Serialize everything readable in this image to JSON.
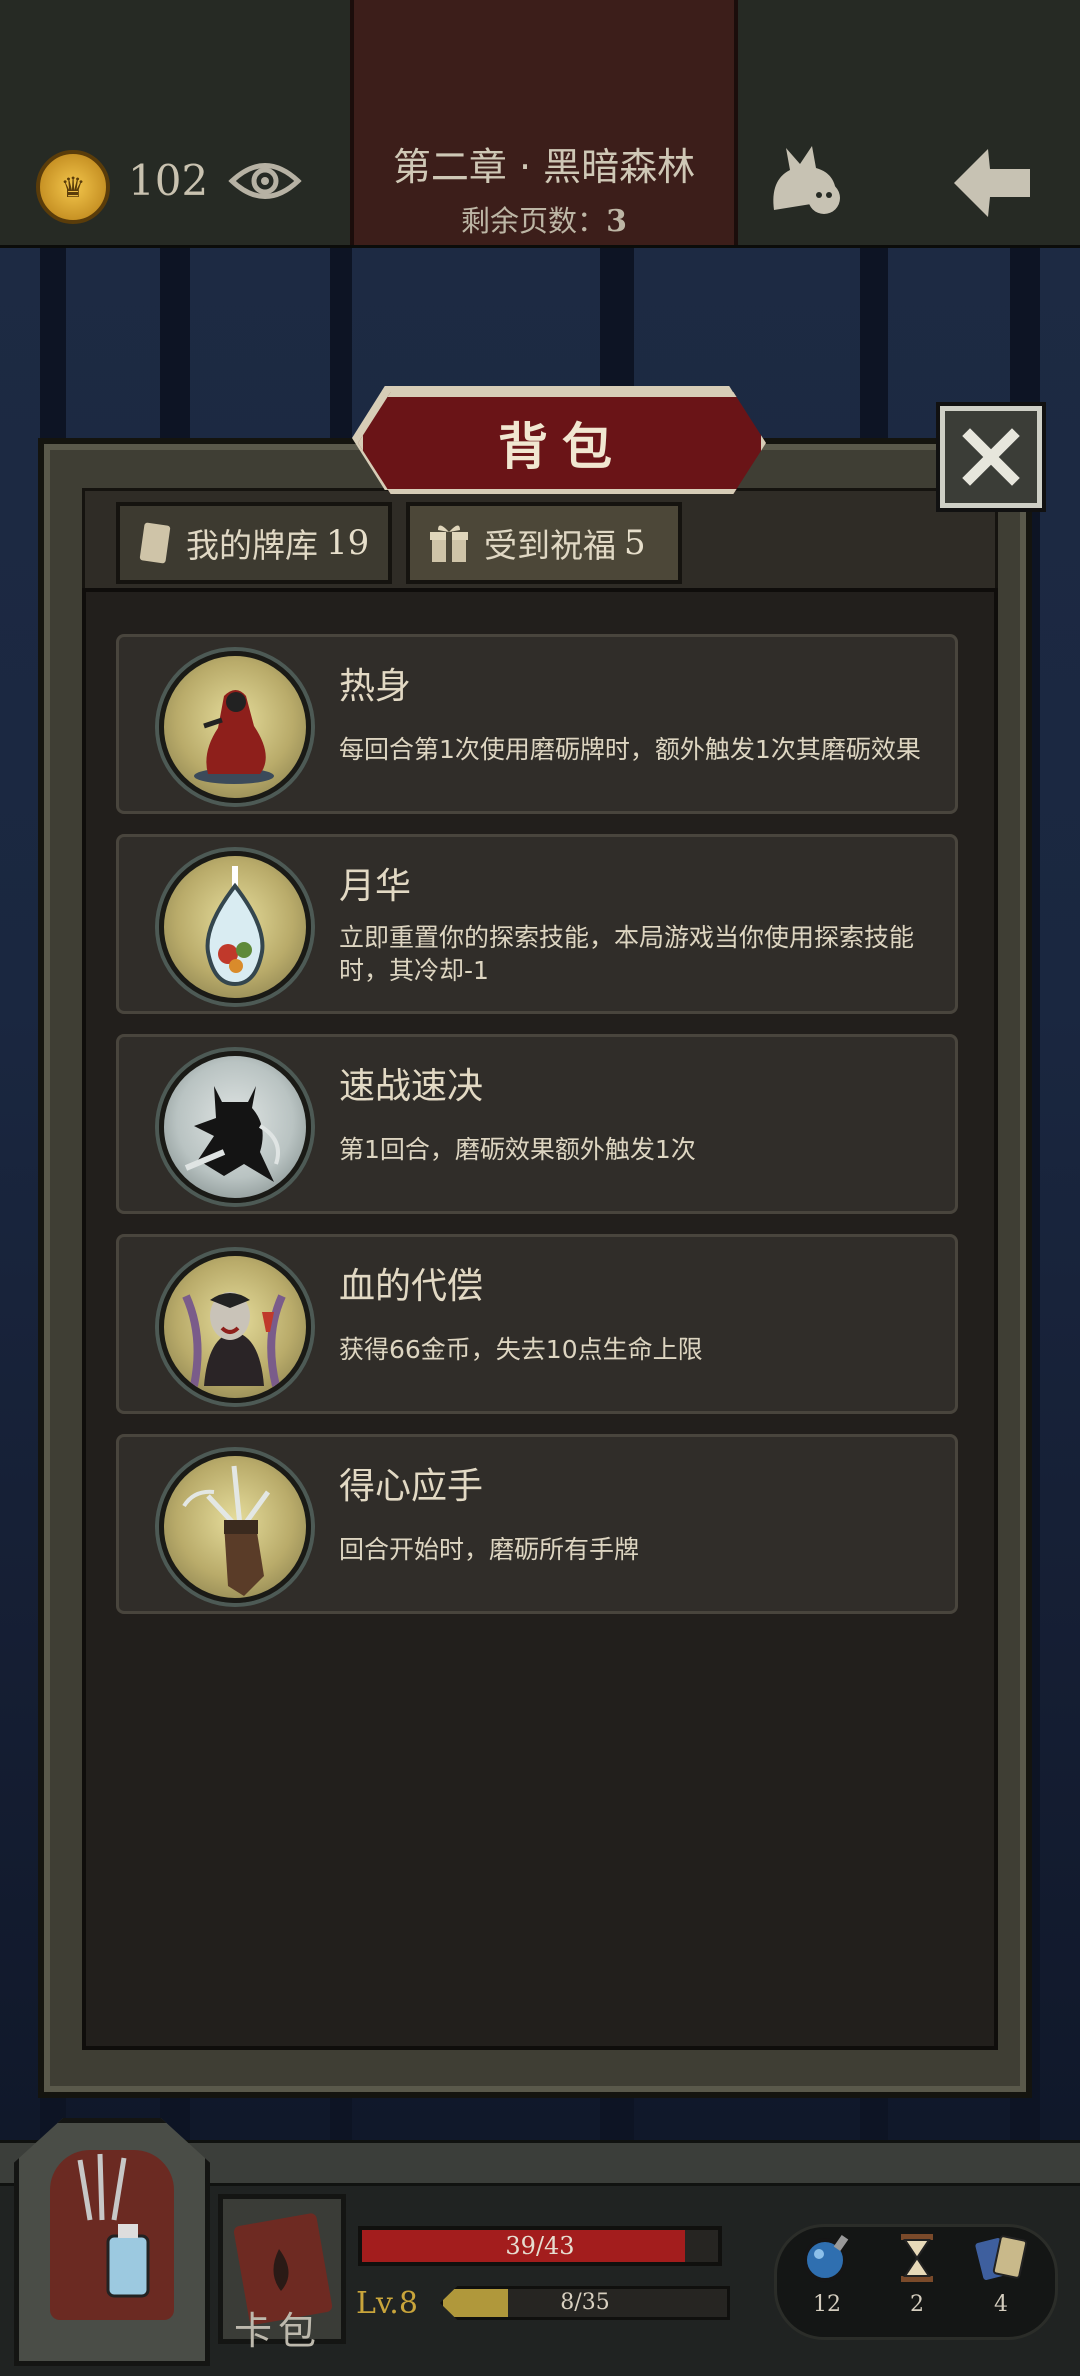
{
  "top_bar": {
    "coin_count": "102",
    "chapter_title": "第二章 · 黑暗森林",
    "pages_left_label": "剩余页数：",
    "pages_left_value": "3"
  },
  "modal": {
    "title": "背包",
    "tabs": [
      {
        "label": "我的牌库",
        "count": "19"
      },
      {
        "label": "受到祝福",
        "count": "5"
      }
    ],
    "blessings": [
      {
        "name": "热身",
        "description": "每回合第1次使用磨砺牌时，额外触发1次其磨砺效果",
        "icon": "red-hooded-figure-icon"
      },
      {
        "name": "月华",
        "description": "立即重置你的探索技能，本局游戏当你使用探索技能时，其冷却-1",
        "icon": "moon-drop-icon"
      },
      {
        "name": "速战速决",
        "description": "第1回合，磨砺效果额外触发1次",
        "icon": "horned-warrior-icon"
      },
      {
        "name": "血的代偿",
        "description": "获得66金币，失去10点生命上限",
        "icon": "vampire-icon"
      },
      {
        "name": "得心应手",
        "description": "回合开始时，磨砺所有手牌",
        "icon": "hand-blades-icon"
      }
    ]
  },
  "bottom_bar": {
    "card_bag_label": "卡包",
    "hp_current": 39,
    "hp_max": 43,
    "hp_text": "39/43",
    "level_text": "Lv.8",
    "xp_current": 8,
    "xp_max": 35,
    "xp_text": "8/35",
    "resources": [
      {
        "icon": "crystal-ball-icon",
        "count": "12"
      },
      {
        "icon": "hourglass-icon",
        "count": "2"
      },
      {
        "icon": "cards-icon",
        "count": "4"
      }
    ]
  },
  "colors": {
    "hp_fill": "#a31d1d",
    "xp_fill": "#b0983b",
    "title_plaque": "#6a1417"
  }
}
